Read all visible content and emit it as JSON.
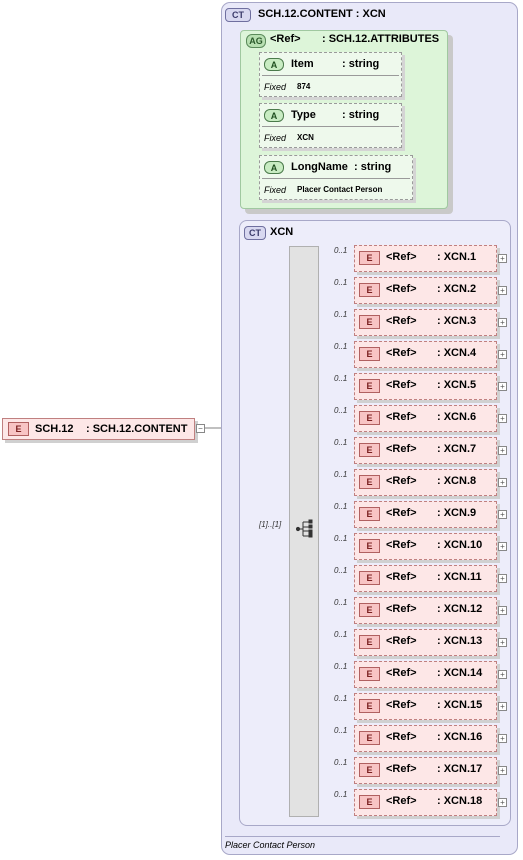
{
  "root_element": {
    "badge": "E",
    "name": "SCH.12",
    "type": ": SCH.12.CONTENT"
  },
  "complex_type": {
    "badge": "CT",
    "title": "SCH.12.CONTENT : XCN"
  },
  "attribute_group": {
    "badge": "AG",
    "ref": "<Ref>",
    "type": ": SCH.12.ATTRIBUTES",
    "attributes": [
      {
        "badge": "A",
        "name": "Item",
        "type": ": string",
        "fixed_label": "Fixed",
        "fixed_value": "874"
      },
      {
        "badge": "A",
        "name": "Type",
        "type": ": string",
        "fixed_label": "Fixed",
        "fixed_value": "XCN"
      },
      {
        "badge": "A",
        "name": "LongName",
        "type": ": string",
        "fixed_label": "Fixed",
        "fixed_value": "Placer Contact Person"
      }
    ]
  },
  "xcn": {
    "badge": "CT",
    "title": "XCN",
    "sequence_occurrence": "[1]..[1]",
    "elements": [
      {
        "occurrence": "0..1",
        "badge": "E",
        "ref": "<Ref>",
        "type": ": XCN.1"
      },
      {
        "occurrence": "0..1",
        "badge": "E",
        "ref": "<Ref>",
        "type": ": XCN.2"
      },
      {
        "occurrence": "0..1",
        "badge": "E",
        "ref": "<Ref>",
        "type": ": XCN.3"
      },
      {
        "occurrence": "0..1",
        "badge": "E",
        "ref": "<Ref>",
        "type": ": XCN.4"
      },
      {
        "occurrence": "0..1",
        "badge": "E",
        "ref": "<Ref>",
        "type": ": XCN.5"
      },
      {
        "occurrence": "0..1",
        "badge": "E",
        "ref": "<Ref>",
        "type": ": XCN.6"
      },
      {
        "occurrence": "0..1",
        "badge": "E",
        "ref": "<Ref>",
        "type": ": XCN.7"
      },
      {
        "occurrence": "0..1",
        "badge": "E",
        "ref": "<Ref>",
        "type": ": XCN.8"
      },
      {
        "occurrence": "0..1",
        "badge": "E",
        "ref": "<Ref>",
        "type": ": XCN.9"
      },
      {
        "occurrence": "0..1",
        "badge": "E",
        "ref": "<Ref>",
        "type": ": XCN.10"
      },
      {
        "occurrence": "0..1",
        "badge": "E",
        "ref": "<Ref>",
        "type": ": XCN.11"
      },
      {
        "occurrence": "0..1",
        "badge": "E",
        "ref": "<Ref>",
        "type": ": XCN.12"
      },
      {
        "occurrence": "0..1",
        "badge": "E",
        "ref": "<Ref>",
        "type": ": XCN.13"
      },
      {
        "occurrence": "0..1",
        "badge": "E",
        "ref": "<Ref>",
        "type": ": XCN.14"
      },
      {
        "occurrence": "0..1",
        "badge": "E",
        "ref": "<Ref>",
        "type": ": XCN.15"
      },
      {
        "occurrence": "0..1",
        "badge": "E",
        "ref": "<Ref>",
        "type": ": XCN.16"
      },
      {
        "occurrence": "0..1",
        "badge": "E",
        "ref": "<Ref>",
        "type": ": XCN.17"
      },
      {
        "occurrence": "0..1",
        "badge": "E",
        "ref": "<Ref>",
        "type": ": XCN.18"
      }
    ]
  },
  "footer_annotation": "Placer Contact Person",
  "colors": {
    "element_fill": "#fde7e7",
    "attribute_fill": "#ddf5d9",
    "complex_type_fill": "#e9e9f9"
  }
}
